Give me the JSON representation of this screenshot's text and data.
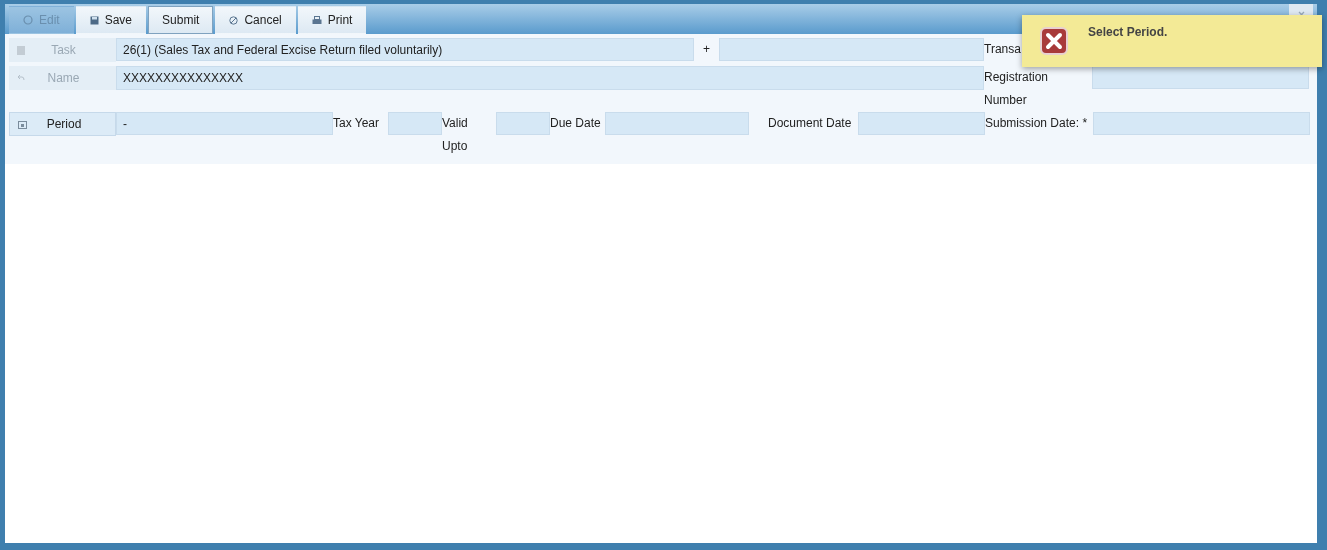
{
  "toolbar": {
    "buttons": [
      {
        "label": "Edit",
        "kind": "edit",
        "disabled": true,
        "focused": false
      },
      {
        "label": "Save",
        "kind": "save",
        "disabled": false,
        "focused": false
      },
      {
        "label": "Submit",
        "kind": "plain",
        "disabled": false,
        "focused": true
      },
      {
        "label": "Cancel",
        "kind": "cancel",
        "disabled": false,
        "focused": false
      },
      {
        "label": "Print",
        "kind": "print",
        "disabled": false,
        "focused": false
      }
    ]
  },
  "form": {
    "task": {
      "label": "Task",
      "disabled": true,
      "value": "26(1) (Sales Tax and Federal Excise Return filed voluntarily)",
      "separator": "+"
    },
    "transaction_date": {
      "label": "Transa"
    },
    "name": {
      "label": "Name",
      "disabled": true,
      "value": "XXXXXXXXXXXXXXX"
    },
    "registration_number": {
      "label": "Registration Number"
    },
    "period": {
      "label": "Period",
      "disabled": false,
      "value": "-"
    },
    "tax_year": {
      "label": "Tax Year"
    },
    "valid_upto": {
      "label": "Valid Upto"
    },
    "due_date": {
      "label": "Due Date"
    },
    "document_date": {
      "label": "Document Date"
    },
    "submission_date": {
      "label": "Submission Date: *"
    }
  },
  "toast": {
    "message": "Select Period."
  }
}
